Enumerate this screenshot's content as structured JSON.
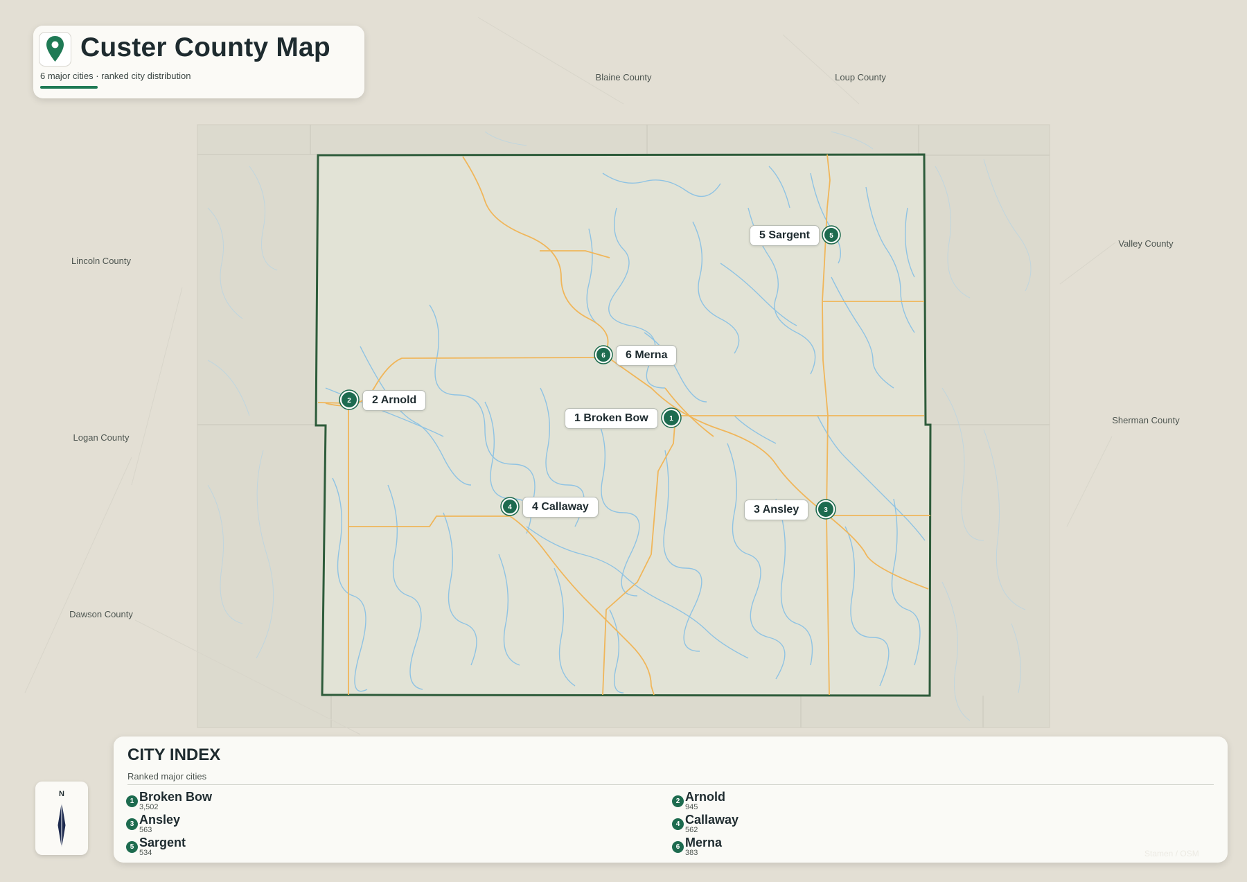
{
  "header": {
    "title": "Custer County Map",
    "subtitle": "6 major cities · ranked city distribution"
  },
  "neighbors": [
    {
      "name": "Blaine County"
    },
    {
      "name": "Loup County"
    },
    {
      "name": "Valley County"
    },
    {
      "name": "Sherman County"
    },
    {
      "name": "Lincoln County"
    },
    {
      "name": "Logan County"
    },
    {
      "name": "Dawson County"
    }
  ],
  "cities": [
    {
      "rank": "1",
      "name": "Broken Bow",
      "label": "1 Broken Bow",
      "population": "3,502"
    },
    {
      "rank": "2",
      "name": "Arnold",
      "label": "2 Arnold",
      "population": "945"
    },
    {
      "rank": "3",
      "name": "Ansley",
      "label": "3 Ansley",
      "population": "563"
    },
    {
      "rank": "4",
      "name": "Callaway",
      "label": "4 Callaway",
      "population": "562"
    },
    {
      "rank": "5",
      "name": "Sargent",
      "label": "5 Sargent",
      "population": "534"
    },
    {
      "rank": "6",
      "name": "Merna",
      "label": "6 Merna",
      "population": "383"
    }
  ],
  "legend": {
    "title": "CITY INDEX",
    "subtitle": "Ranked major cities"
  },
  "compass": {
    "north_label": "N"
  },
  "watermark": "Stamen / OSM",
  "colors": {
    "background": "#e3dfd4",
    "county_fill": "#e2e3d6",
    "county_border": "#2d5b3a",
    "rivers": "#8fc3e3",
    "roads": "#f0b65a",
    "marker": "#1d6b4f"
  }
}
